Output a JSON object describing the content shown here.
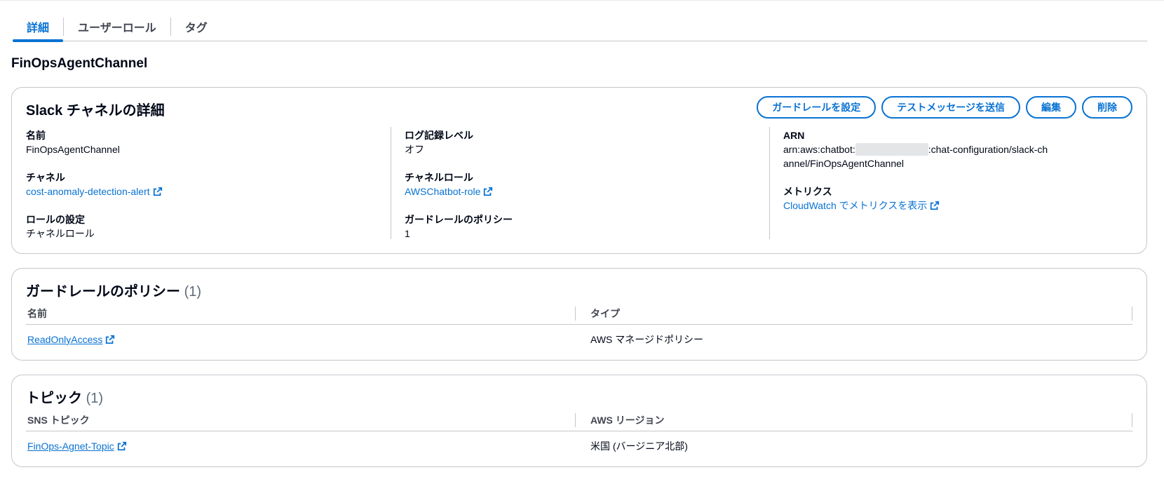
{
  "tabs": [
    {
      "label": "詳細",
      "active": true
    },
    {
      "label": "ユーザーロール",
      "active": false
    },
    {
      "label": "タグ",
      "active": false
    }
  ],
  "page_title": "FinOpsAgentChannel",
  "details": {
    "title": "Slack チャネルの詳細",
    "actions": {
      "guardrail": "ガードレールを設定",
      "test_message": "テストメッセージを送信",
      "edit": "編集",
      "delete": "削除"
    },
    "name": {
      "key": "名前",
      "value": "FinOpsAgentChannel"
    },
    "channel": {
      "key": "チャネル",
      "value": "cost-anomaly-detection-alert"
    },
    "role_setting": {
      "key": "ロールの設定",
      "value": "チャネルロール"
    },
    "log_level": {
      "key": "ログ記録レベル",
      "value": "オフ"
    },
    "channel_role": {
      "key": "チャネルロール",
      "value": "AWSChatbot-role"
    },
    "guardrail_policy": {
      "key": "ガードレールのポリシー",
      "value": "1"
    },
    "arn": {
      "key": "ARN",
      "prefix": "arn:aws:chatbot:",
      "suffix": ":chat-configuration/slack-channel/FinOpsAgentChannel"
    },
    "metrics": {
      "key": "メトリクス",
      "value": "CloudWatch でメトリクスを表示"
    }
  },
  "guardrails": {
    "title": "ガードレールのポリシー",
    "count": "(1)",
    "columns": [
      "名前",
      "タイプ"
    ],
    "rows": [
      {
        "name": "ReadOnlyAccess",
        "type": "AWS マネージドポリシー"
      }
    ]
  },
  "topics": {
    "title": "トピック",
    "count": "(1)",
    "columns": [
      "SNS トピック",
      "AWS リージョン"
    ],
    "rows": [
      {
        "name": "FinOps-Agnet-Topic",
        "region": "米国 (バージニア北部)"
      }
    ]
  },
  "colors": {
    "accent": "#0972d3",
    "border": "#c6c6cd",
    "text": "#000716"
  }
}
